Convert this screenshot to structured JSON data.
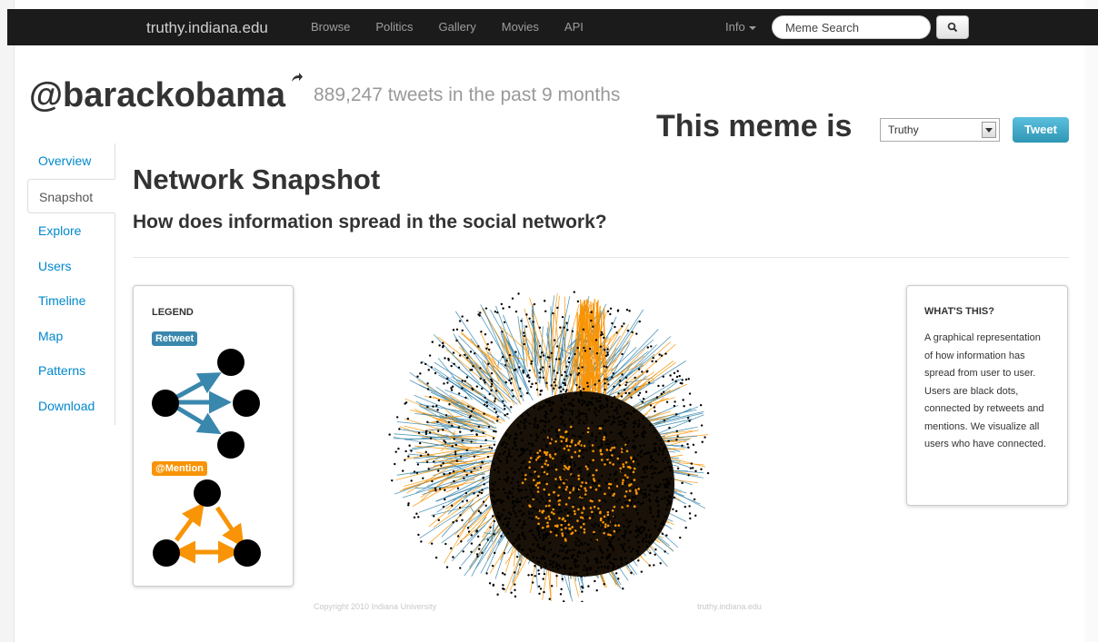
{
  "navbar": {
    "brand": "truthy.indiana.edu",
    "links": [
      "Browse",
      "Politics",
      "Gallery",
      "Movies",
      "API"
    ],
    "info": "Info",
    "search_placeholder": "Meme Search"
  },
  "header": {
    "meme": "@barackobama",
    "tweet_count": "889,247 tweets in the past 9 months",
    "meme_is_label": "This meme is",
    "meme_select_value": "Truthy",
    "tweet_button": "Tweet"
  },
  "sidebar": {
    "items": [
      {
        "label": "Overview",
        "active": false
      },
      {
        "label": "Snapshot",
        "active": true
      },
      {
        "label": "Explore",
        "active": false
      },
      {
        "label": "Users",
        "active": false
      },
      {
        "label": "Timeline",
        "active": false
      },
      {
        "label": "Map",
        "active": false
      },
      {
        "label": "Patterns",
        "active": false
      },
      {
        "label": "Download",
        "active": false
      }
    ]
  },
  "main": {
    "title": "Network Snapshot",
    "subtitle": "How does information spread in the social network?"
  },
  "legend": {
    "title": "LEGEND",
    "retweet": "Retweet",
    "mention": "@Mention"
  },
  "whats_this": {
    "title": "WHAT'S THIS?",
    "text": "A graphical representation of how information has spread from user to user. Users are black dots, connected by retweets and mentions. We visualize all users who have connected."
  },
  "network": {
    "copyright": "Copyright 2010 Indiana University",
    "watermark": "truthy.indiana.edu"
  },
  "colors": {
    "retweet": "#3a87ad",
    "mention": "#f89406",
    "node": "#000000",
    "link": "#0088cc"
  }
}
